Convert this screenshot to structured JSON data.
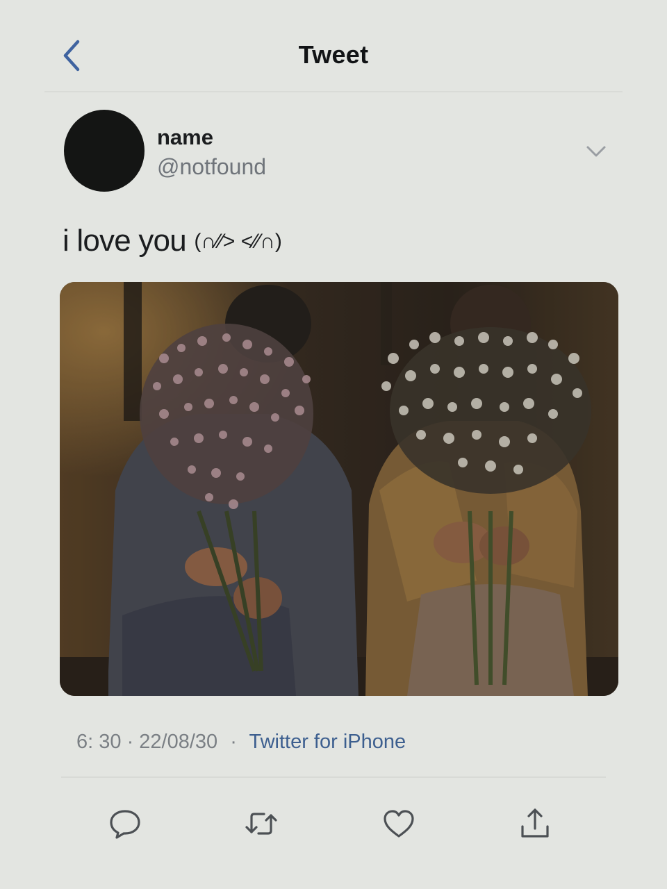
{
  "nav": {
    "title": "Tweet",
    "back_icon": "chevron-left-icon"
  },
  "author": {
    "display_name": "name",
    "handle": "@notfound"
  },
  "tweet": {
    "text": "i love you",
    "kaomoji": "(∩⁄⁄> <⁄⁄∩)",
    "image_alt": "Two people sitting side by side holding bouquets of flowers in front of their faces"
  },
  "meta": {
    "time": "6: 30",
    "date": "22/08/30",
    "separator": "·",
    "source": "Twitter for iPhone"
  },
  "actions": [
    {
      "name": "reply",
      "icon": "reply-icon"
    },
    {
      "name": "retweet",
      "icon": "retweet-icon"
    },
    {
      "name": "like",
      "icon": "heart-icon"
    },
    {
      "name": "share",
      "icon": "share-icon"
    }
  ],
  "colors": {
    "background": "#e3e5e1",
    "accent": "#3d5f8f",
    "secondary_text": "#6f747a"
  }
}
